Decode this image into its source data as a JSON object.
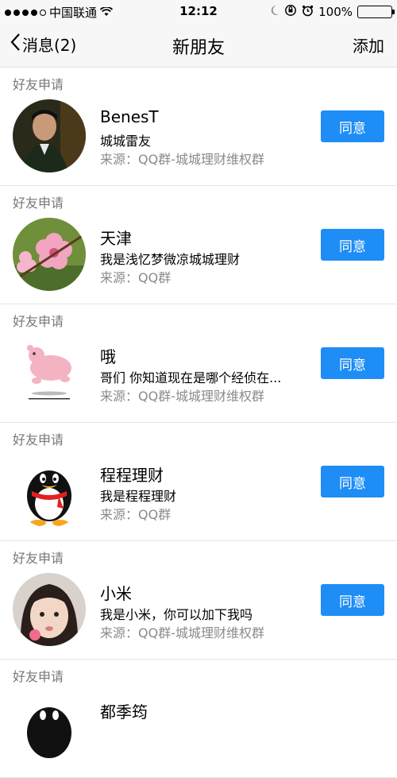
{
  "status_bar": {
    "carrier": "中国联通",
    "time": "12:12",
    "battery": "100%",
    "battery_level": 1.0,
    "signal_dots_filled": 4,
    "icons": [
      "signal-icon",
      "wifi-icon",
      "moon-icon",
      "rotation-lock-icon",
      "alarm-icon",
      "battery-icon"
    ]
  },
  "nav": {
    "back_label": "消息(2)",
    "title": "新朋友",
    "add_label": "添加"
  },
  "requests": [
    {
      "section": "好友申请",
      "name": "BenesT",
      "message": "城城雷友",
      "source": "来源：QQ群-城城理财维权群",
      "button": "同意",
      "avatar": "man-photo"
    },
    {
      "section": "好友申请",
      "name": "天津",
      "message": "我是浅忆梦微凉城城理财",
      "source": "来源：QQ群",
      "button": "同意",
      "avatar": "flower-photo"
    },
    {
      "section": "好友申请",
      "name": "哦",
      "message": "哥们 你知道现在是哪个经侦在...",
      "source": "来源：QQ群-城城理财维权群",
      "button": "同意",
      "avatar": "pink-bear"
    },
    {
      "section": "好友申请",
      "name": "程程理财",
      "message": "我是程程理财",
      "source": "来源：QQ群",
      "button": "同意",
      "avatar": "qq-penguin"
    },
    {
      "section": "好友申请",
      "name": "小米",
      "message": "我是小米，你可以加下我吗",
      "source": "来源：QQ群-城城理财维权群",
      "button": "同意",
      "avatar": "girl-photo"
    },
    {
      "section": "好友申请",
      "name": "都季筠",
      "message": "",
      "source": "",
      "button": "",
      "avatar": "qq-penguin"
    }
  ],
  "colors": {
    "accent": "#1e8df5",
    "nav_bg": "#f7f7f7",
    "secondary_text": "#8a8a8a",
    "battery_fill": "#4cd964"
  }
}
